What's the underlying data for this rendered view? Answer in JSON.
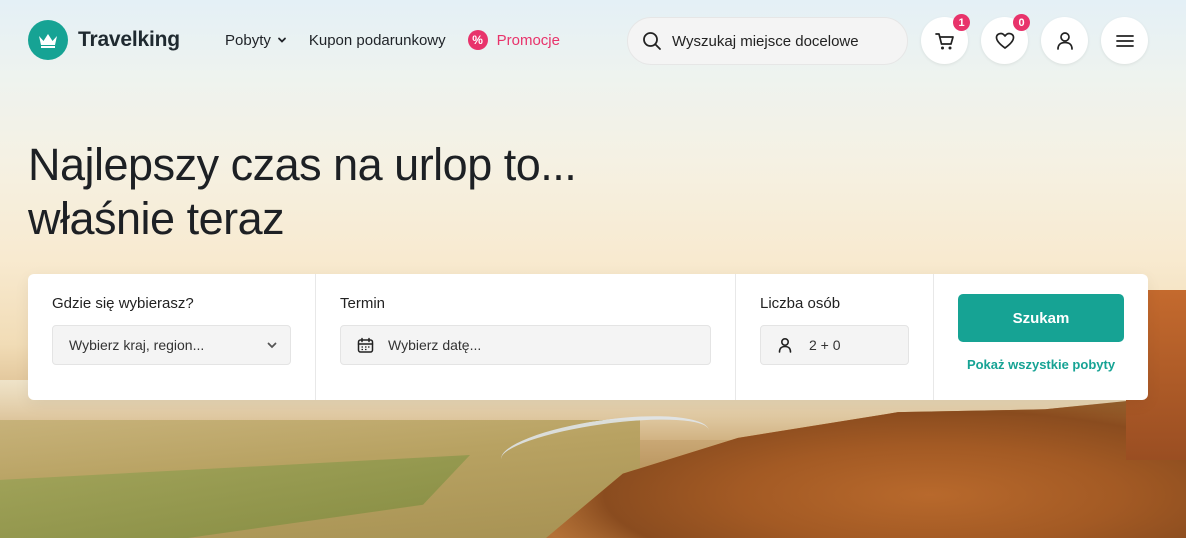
{
  "brand": {
    "name": "Travelking",
    "color": "#16a394"
  },
  "nav": {
    "stays_label": "Pobyty",
    "voucher_label": "Kupon podarunkowy",
    "promo_label": "Promocje",
    "promo_badge": "%",
    "promo_color": "#e8336b"
  },
  "search": {
    "placeholder": "Wyszukaj miejsce docelowe"
  },
  "header_icons": {
    "cart_count": "1",
    "wishlist_count": "0"
  },
  "hero": {
    "line1": "Najlepszy czas na urlop to...",
    "line2": "właśnie teraz"
  },
  "panel": {
    "destination": {
      "label": "Gdzie się wybierasz?",
      "placeholder": "Wybierz kraj, region..."
    },
    "date": {
      "label": "Termin",
      "placeholder": "Wybierz datę..."
    },
    "guests": {
      "label": "Liczba osób",
      "value": "2 + 0"
    },
    "search_button": "Szukam",
    "show_all_link": "Pokaż wszystkie pobyty"
  }
}
